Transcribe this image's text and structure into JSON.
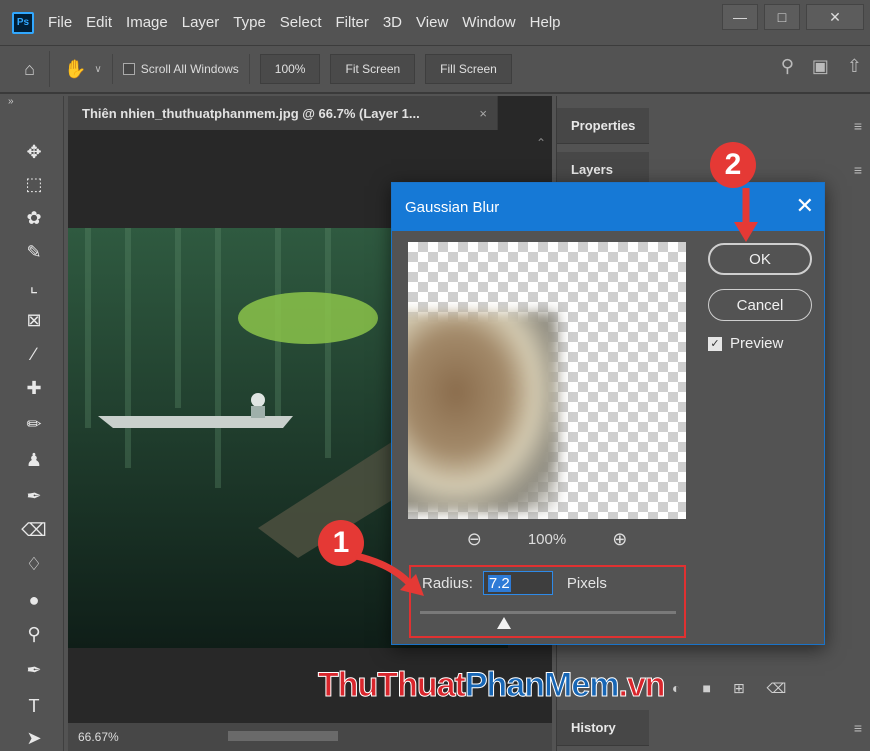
{
  "app": {
    "logo": "Ps",
    "menu": [
      "File",
      "Edit",
      "Image",
      "Layer",
      "Type",
      "Select",
      "Filter",
      "3D",
      "View",
      "Window",
      "Help"
    ],
    "window_buttons": [
      "—",
      "□",
      "✕"
    ]
  },
  "options": {
    "scroll_all": "Scroll All Windows",
    "btn_100": "100%",
    "btn_fit": "Fit Screen",
    "btn_fill": "Fill Screen"
  },
  "document": {
    "tab_title": "Thiên nhien_thuthuatphanmem.jpg @ 66.7% (Layer 1...",
    "tab_close": "×",
    "zoom_status": "66.67%"
  },
  "panels": {
    "properties": "Properties",
    "layers": "Layers",
    "history": "History"
  },
  "dialog": {
    "title": "Gaussian Blur",
    "close": "✕",
    "ok": "OK",
    "cancel": "Cancel",
    "preview_label": "Preview",
    "preview_checked": true,
    "zoom_level": "100%",
    "radius_label": "Radius:",
    "radius_value": "7.2",
    "radius_unit": "Pixels",
    "radius_slider_fraction": 0.33
  },
  "annotations": {
    "marker1": "1",
    "marker2": "2"
  },
  "watermark": {
    "part1": "ThuThuat",
    "part2": "PhanMem",
    "part3": ".vn"
  },
  "colors": {
    "dialog_title_bg": "#1679d6",
    "annotation_red": "#e53935"
  }
}
